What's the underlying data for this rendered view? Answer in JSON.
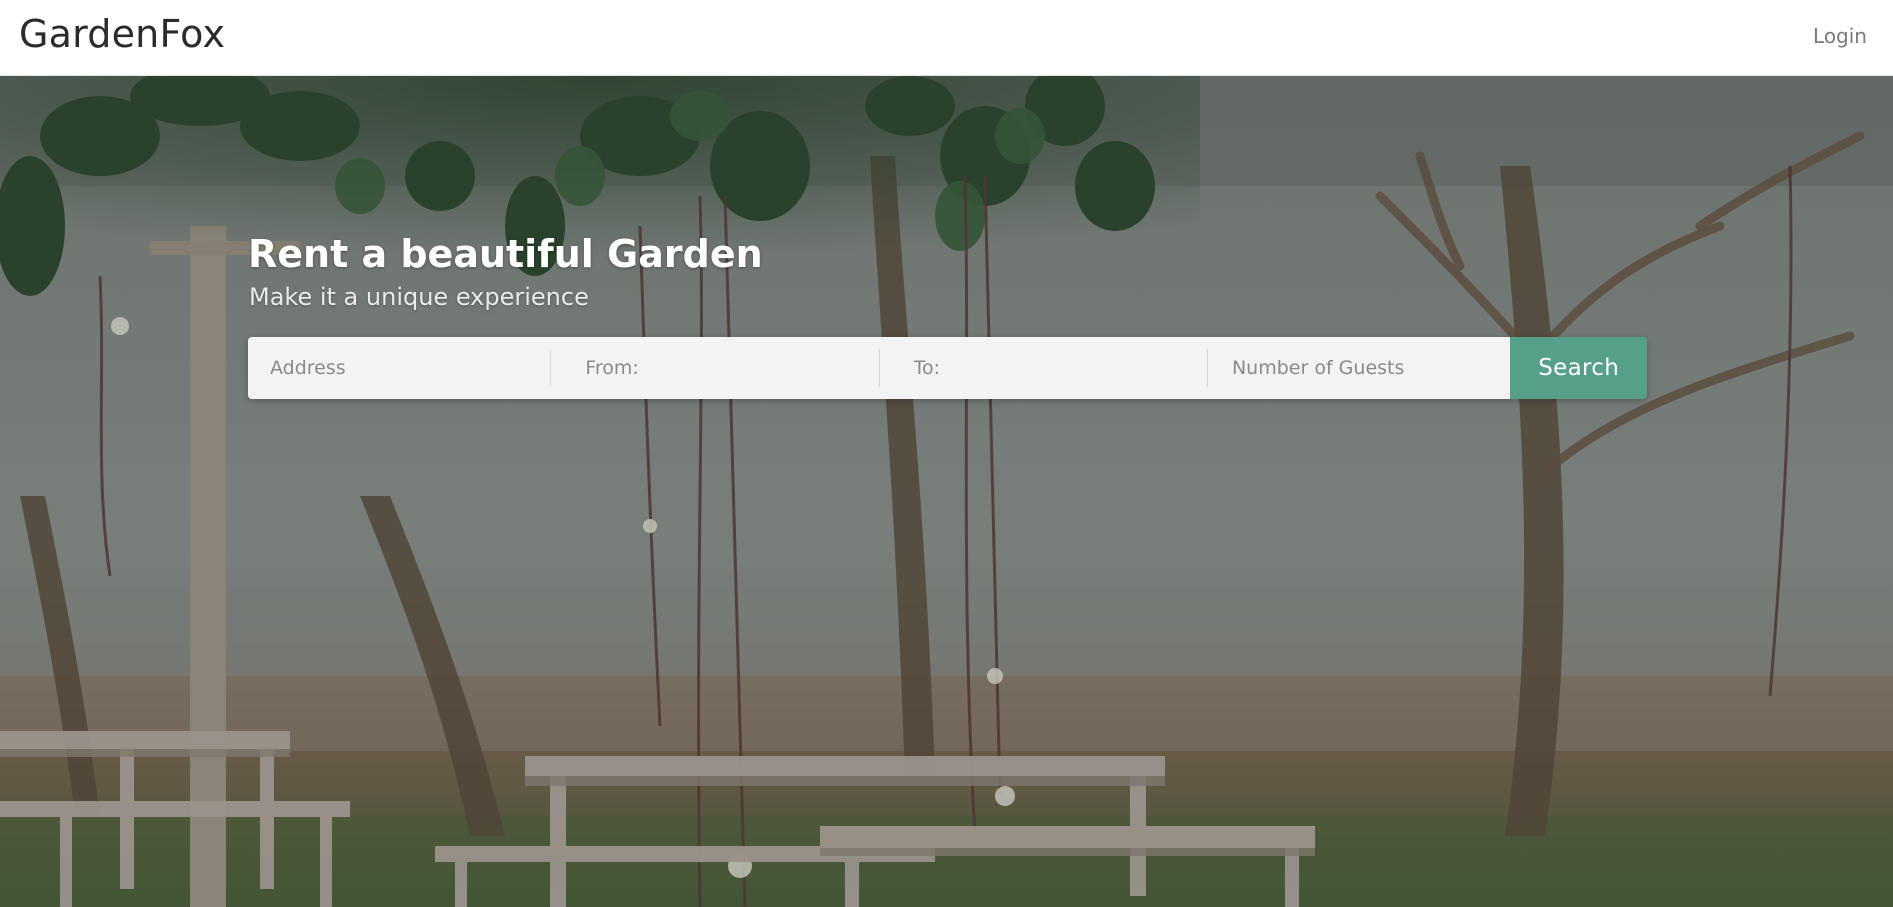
{
  "navbar": {
    "brand": "GardenFox",
    "login_label": "Login"
  },
  "hero": {
    "title": "Rent a beautiful Garden",
    "subtitle": "Make it a unique experience",
    "background_image": "garden-with-benches-and-hanging-vines-photo"
  },
  "search": {
    "address_placeholder": "Address",
    "from_placeholder": "From:",
    "to_placeholder": "To:",
    "guests_placeholder": "Number of Guests",
    "button_label": "Search"
  },
  "colors": {
    "accent": "#56a08a",
    "navbar_bg": "#ffffff",
    "input_bg": "#f3f3f3"
  }
}
